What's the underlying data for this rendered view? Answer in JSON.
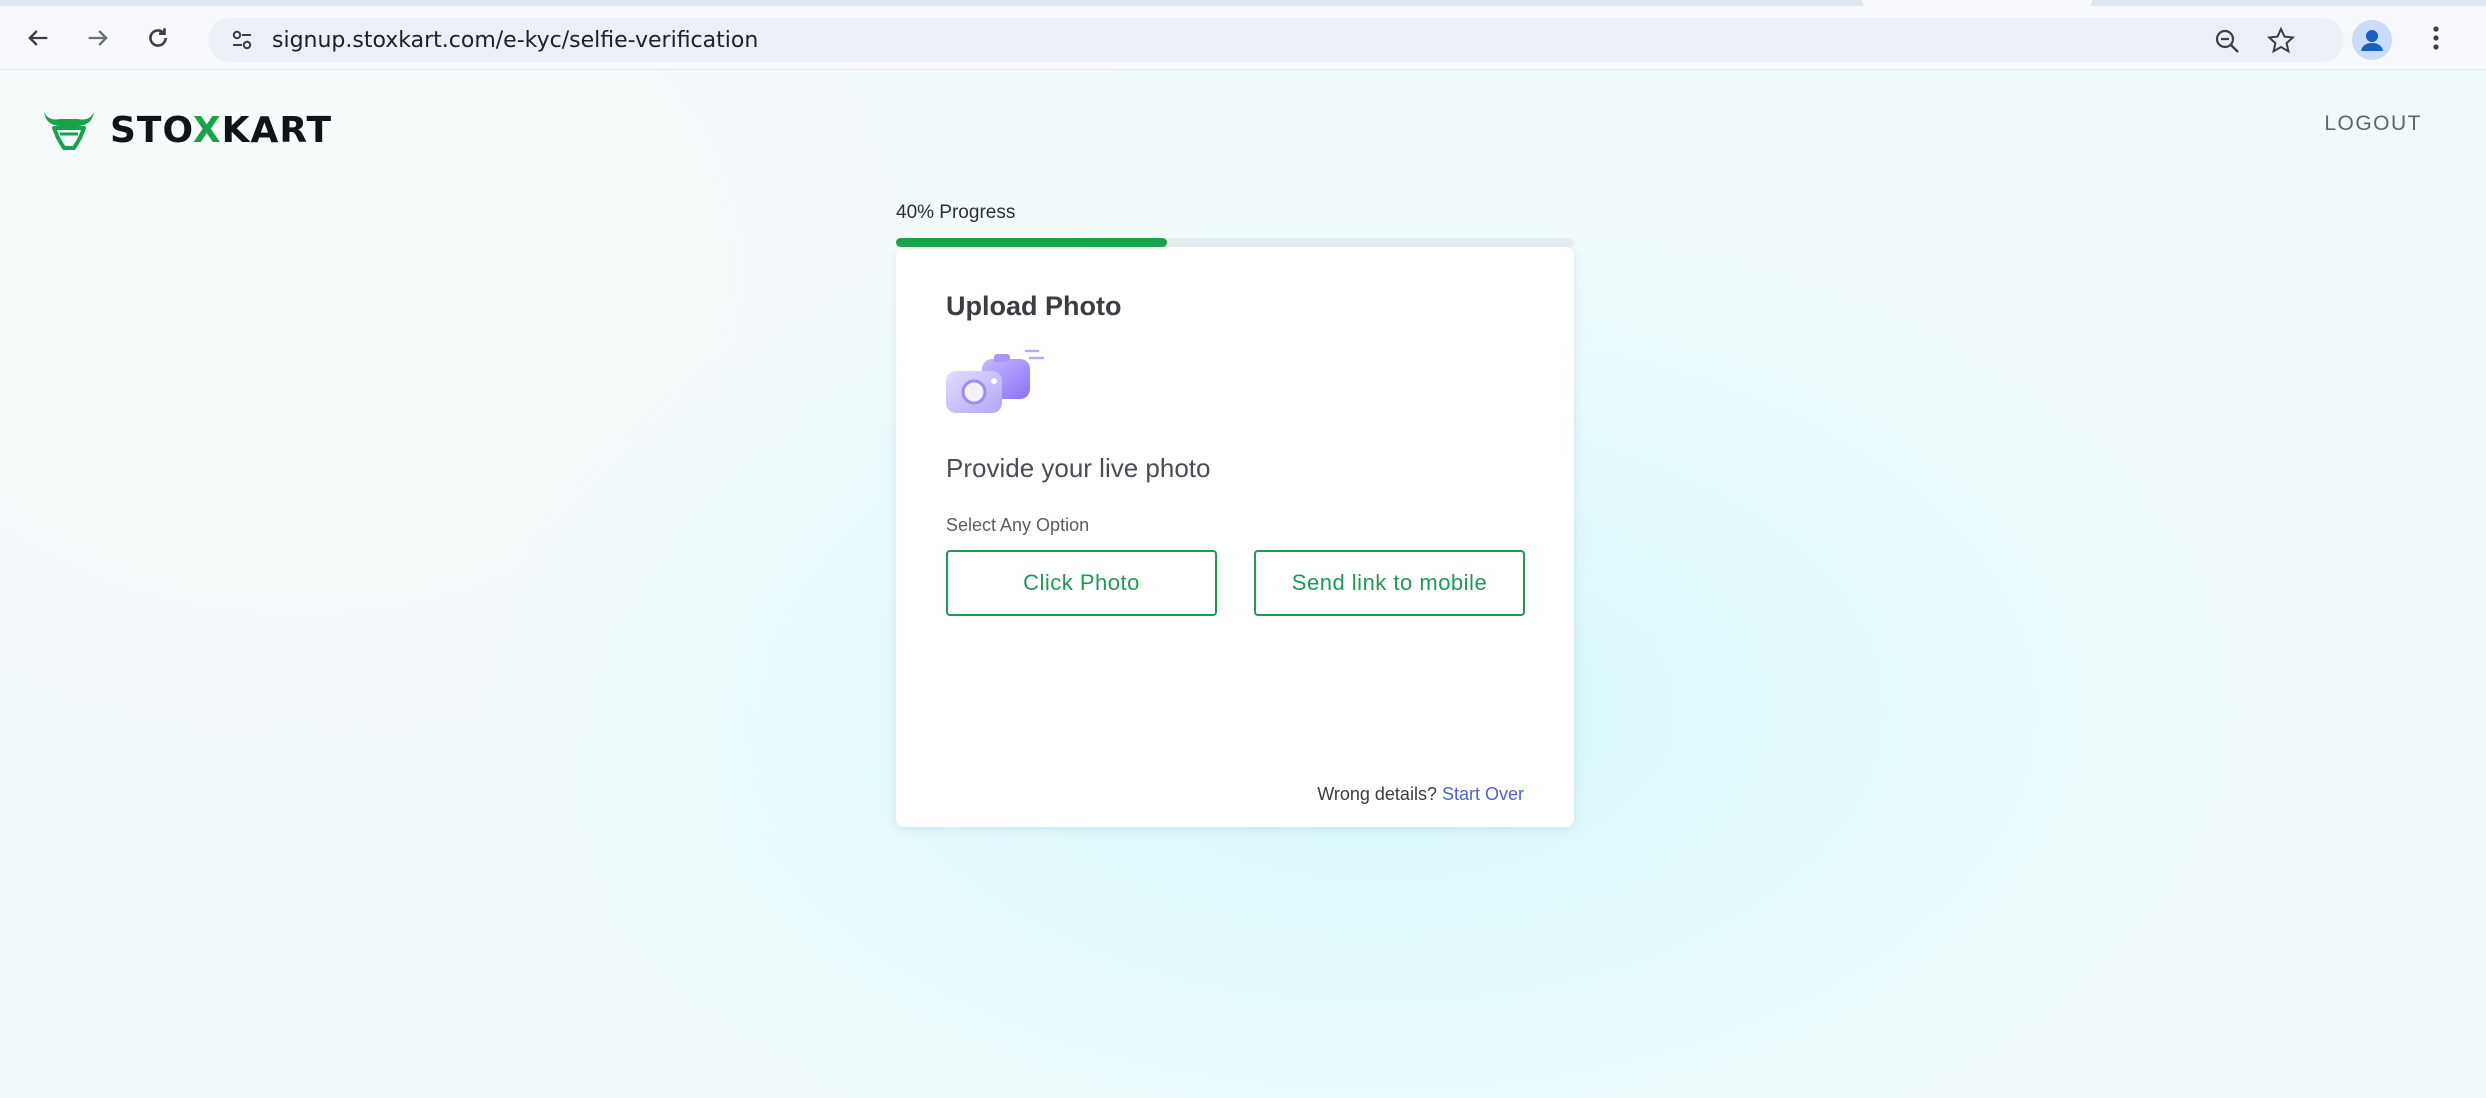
{
  "browser": {
    "url": "signup.stoxkart.com/e-kyc/selfie-verification",
    "back_icon": "arrow-left-icon",
    "forward_icon": "arrow-right-icon",
    "reload_icon": "reload-icon",
    "site_info_icon": "tune-icon",
    "zoom_icon": "zoom-out-icon",
    "bookmark_icon": "star-icon",
    "profile_icon": "person-icon",
    "menu_icon": "kebab-icon"
  },
  "header": {
    "brand_prefix": "STO",
    "brand_x": "X",
    "brand_suffix": "KART",
    "logout_label": "LOGOUT"
  },
  "progress": {
    "label": "40% Progress",
    "value": 0.4
  },
  "card": {
    "title": "Upload Photo",
    "icon": "camera-icon",
    "subhead": "Provide your live photo",
    "option_label": "Select Any Option",
    "options": [
      "Click Photo",
      "Send link to mobile"
    ],
    "footer_text": "Wrong details?",
    "footer_link": "Start Over"
  },
  "colors": {
    "accent": "#16a34a",
    "button": "#1f9a52",
    "link": "#4b63d6"
  }
}
